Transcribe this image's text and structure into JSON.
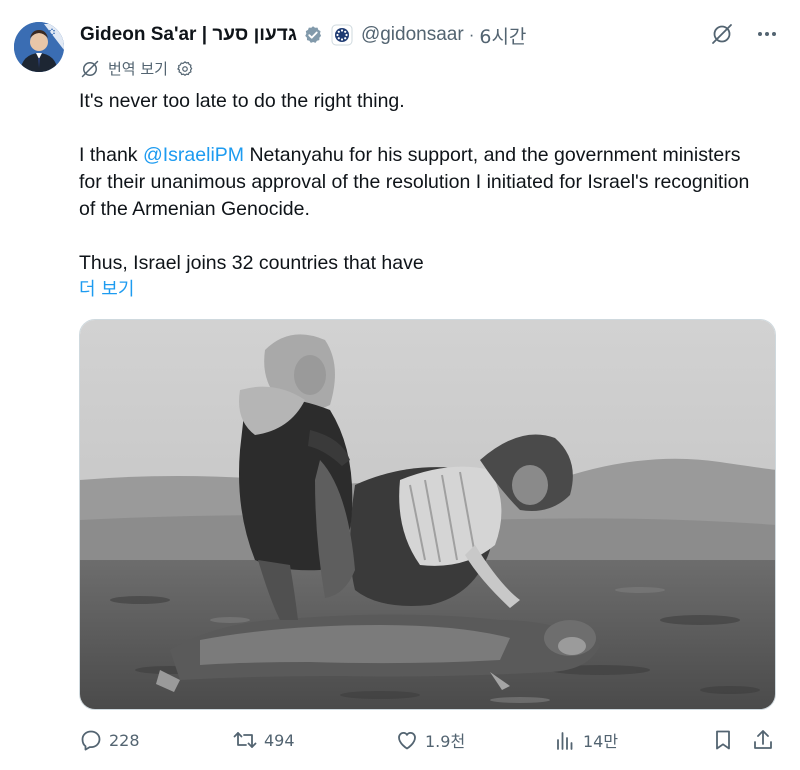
{
  "author": {
    "display_name": "Gideon Sa'ar | גדעון סער",
    "handle": "@gidonsaar",
    "separator": "·",
    "timestamp": "6시간",
    "avatar_icon": "avatar-image",
    "verified_color": "#829aab"
  },
  "translate": {
    "label": "번역 보기"
  },
  "tweet": {
    "line1": "It's never too late to do the right thing.",
    "p2_before": "I thank ",
    "p2_mention": "@IsraeliPM",
    "p2_after": " Netanyahu for his support, and the government ministers for their unanimous approval of the resolution I initiated for Israel's recognition of the Armenian Genocide.",
    "p3": "Thus, Israel joins 32 countries that have",
    "show_more": "더 보기"
  },
  "media": {
    "kind": "black-and-white photograph"
  },
  "actions": {
    "replies": "228",
    "reposts": "494",
    "likes": "1.9천",
    "views": "14만"
  },
  "colors": {
    "accent": "#1d9bf0",
    "secondary_text": "#536471",
    "primary_text": "#0f1419"
  }
}
